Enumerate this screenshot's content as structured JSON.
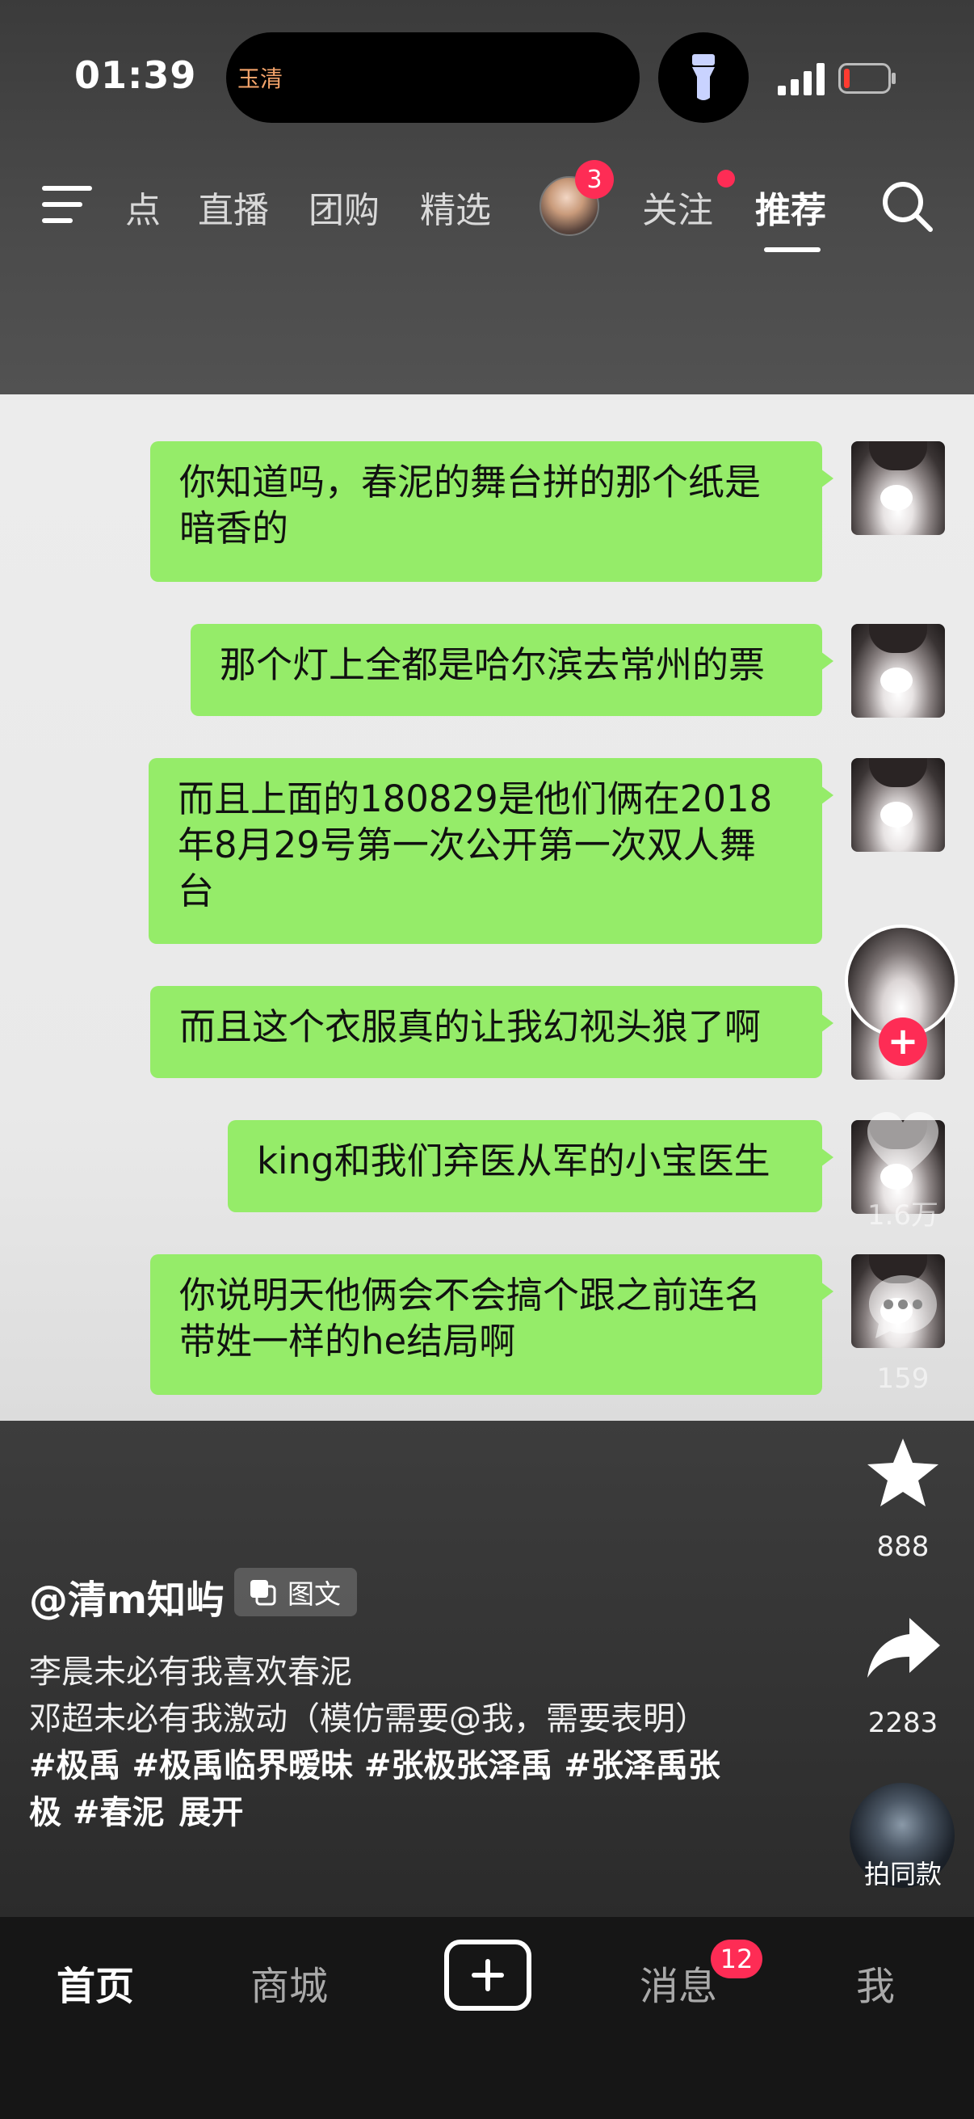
{
  "status_bar": {
    "time": "01:39",
    "island_text": "玉清",
    "torch_icon": "flashlight-icon",
    "battery_color": "#ff3b30"
  },
  "top_nav": {
    "items": [
      "点",
      "直播",
      "团购",
      "精选",
      "关注",
      "推荐"
    ],
    "active": "推荐",
    "avatar_badge": "3"
  },
  "chat": {
    "messages": [
      "你知道吗，春泥的舞台拼的那个纸是暗香的",
      "那个灯上全都是哈尔滨去常州的票",
      "而且上面的180829是他们俩在2018年8月29号第一次公开第一次双人舞台",
      "而且这个衣服真的让我幻视头狼了啊",
      "king和我们弃医从军的小宝医生",
      "你说明天他俩会不会搞个跟之前连名带姓一样的he结局啊"
    ]
  },
  "actions": {
    "likes": "1.6万",
    "comments": "159",
    "favorites": "888",
    "shares": "2283",
    "same_style": "拍同款"
  },
  "post": {
    "author": "@清m知屿",
    "type_label": "图文",
    "caption_line1": "李晨未必有我喜欢春泥",
    "caption_line2": "邓超未必有我激动（模仿需要@我，需要表明）",
    "hashtags": "#极禹 #极禹临界暧昧 #张极张泽禹 #张泽禹张极 #春泥",
    "expand": "展开"
  },
  "tabbar": {
    "items": [
      "首页",
      "商城",
      "消息",
      "我"
    ],
    "active": "首页",
    "messages_badge": "12"
  },
  "colors": {
    "accent": "#fe2c55",
    "bubble": "#95ec69"
  }
}
